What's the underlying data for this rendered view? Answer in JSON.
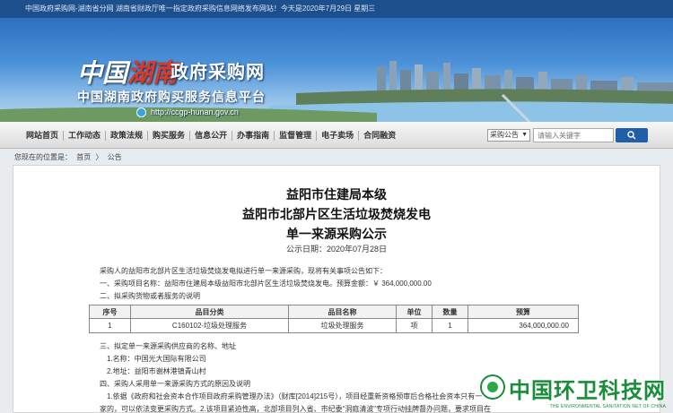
{
  "topbar": {
    "text": "中国政府采购网-湖南省分网  湖南省财政厅唯一指定政府采购信息网络发布网站！今天是2020年7月29日 星期三"
  },
  "banner": {
    "logo_part1": "中国",
    "logo_part2": "湖南",
    "title": "政府采购网",
    "subtitle": "中国湖南政府购买服务信息平台",
    "url": "http://ccgp-hunan.gov.cn"
  },
  "nav": {
    "items": [
      "网站首页",
      "工作动态",
      "政策法规",
      "购买服务",
      "信息公开",
      "办事指南",
      "监督管理",
      "电子卖场",
      "合同融资"
    ]
  },
  "search": {
    "category": "采购公告",
    "placeholder": "请输入关键字"
  },
  "breadcrumb": {
    "prefix": "您现在的位置是：",
    "home": "首页",
    "sep": "〉",
    "current": "公告"
  },
  "document": {
    "title_line1": "益阳市住建局本级",
    "title_line2": "益阳市北部片区生活垃圾焚烧发电",
    "title_line3": "单一来源采购公示",
    "date": "公示日期：2020年07月28日",
    "intro": "采购人的益阳市北部片区生活垃圾焚烧发电拟进行单一来源采购，现将有关事项公告如下：",
    "item1": "一、采购项目名称：益阳市住建局本级益阳市北部片区生活垃圾焚烧发电。预算金额：￥ 364,000,000.00",
    "item2": "二、拟采购货物或者服务的说明",
    "item3": "三、拟定单一来源采购供应商的名称、地址",
    "item3_1": "1.名称：中国光大国际有限公司",
    "item3_2": "2.地址：益阳市谢林港镇青山村",
    "item4": "四、采购人采用单一来源采购方式的原因及说明",
    "item4_1": "1.依据《政府和社会资本合作项目政府采购管理办法》（财库[2014]215号），项目经重新资格预审后合格社会资本只有一",
    "item4_2": "家的，可以依法变更采购方式。2.该项目紧迫性高，北部项目列入省、市纪委“洞庭清波”专项行动挂牌督办问题，要求项目在"
  },
  "table": {
    "headers": [
      "序号",
      "品目分类",
      "品目名称",
      "单位",
      "数量",
      "预算"
    ],
    "rows": [
      [
        "1",
        "C160102-垃圾处理服务",
        "垃圾处理服务",
        "项",
        "1",
        "364,000,000.00"
      ]
    ]
  },
  "watermark": {
    "main": "中国环卫科技网",
    "sub": "THE ENVIRONMENTAL SANITATION NET OF CHINA"
  }
}
